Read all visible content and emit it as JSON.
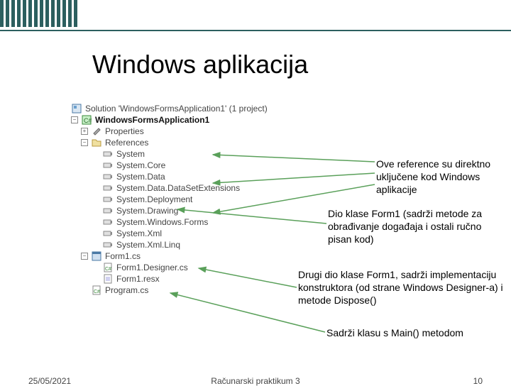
{
  "title": "Windows aplikacija",
  "tree": {
    "solution": "Solution 'WindowsFormsApplication1' (1 project)",
    "project": "WindowsFormsApplication1",
    "properties": "Properties",
    "references": "References",
    "refs": [
      "System",
      "System.Core",
      "System.Data",
      "System.Data.DataSetExtensions",
      "System.Deployment",
      "System.Drawing",
      "System.Windows.Forms",
      "System.Xml",
      "System.Xml.Linq"
    ],
    "form": "Form1.cs",
    "form_designer": "Form1.Designer.cs",
    "form_resx": "Form1.resx",
    "program": "Program.cs"
  },
  "annotations": {
    "a1": "Ove reference su direktno uključene kod Windows aplikacije",
    "a2": "Dio klase Form1 (sadrži metode za obrađivanje događaja i ostali ručno pisan kod)",
    "a3": "Drugi dio klase Form1, sadrži implementaciju konstruktora (od strane Windows Designer-a) i metode Dispose()",
    "a4": "Sadrži klasu s Main() metodom"
  },
  "footer": {
    "date": "25/05/2021",
    "center": "Računarski praktikum 3",
    "page": "10"
  }
}
